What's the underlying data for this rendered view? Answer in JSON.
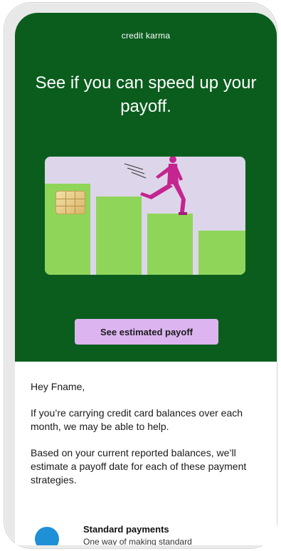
{
  "email": {
    "brand": "credit karma",
    "headline": "See if you can speed up your payoff.",
    "cta_label": "See estimated payoff",
    "greeting": "Hey Fname,",
    "paragraph_1": "If you’re carrying credit card balances over each month, we may be able to help.",
    "paragraph_2": "Based on your current reported balances, we’ll estimate a payoff date for each of these payment strategies.",
    "strategy": {
      "title": "Standard payments",
      "description": "One way of making standard"
    }
  },
  "colors": {
    "hero_bg": "#0b5d1e",
    "cta_bg": "#dcb5f0",
    "bars": "#8fd55a",
    "card_bg": "#ddd6ea",
    "runner": "#c4258f",
    "strategy_icon": "#1e90d6"
  },
  "icons": {
    "card_chip": "chip-icon",
    "strategy": "strategy-icon"
  }
}
